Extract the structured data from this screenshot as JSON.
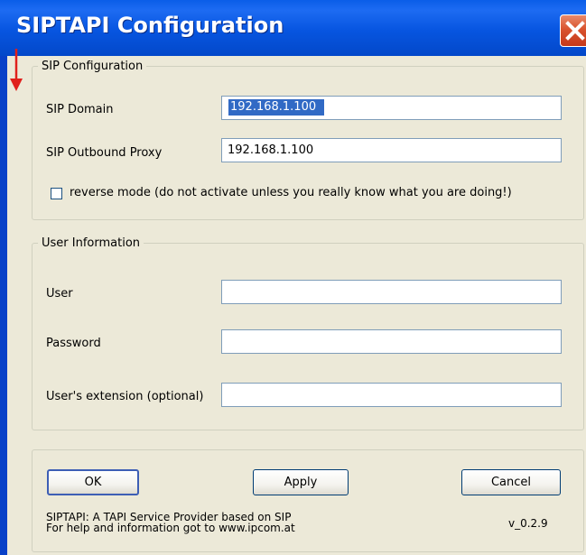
{
  "window": {
    "title": "SIPTAPI Configuration"
  },
  "sip_config": {
    "legend": "SIP Configuration",
    "domain_label": "SIP Domain",
    "domain_value": "192.168.1.100",
    "proxy_label": "SIP Outbound Proxy",
    "proxy_value": "192.168.1.100",
    "reverse_mode_label": "reverse mode (do not activate unless you really know what you are doing!)",
    "reverse_mode_checked": false
  },
  "user_info": {
    "legend": "User Information",
    "user_label": "User",
    "user_value": "",
    "password_label": "Password",
    "password_value": "",
    "extension_label": "User's extension (optional)",
    "extension_value": ""
  },
  "buttons": {
    "ok": "OK",
    "apply": "Apply",
    "cancel": "Cancel"
  },
  "footer": {
    "line1": "SIPTAPI: A TAPI Service Provider based on SIP",
    "line2": "For help and information got to www.ipcom.at",
    "version": "v_0.2.9"
  },
  "colors": {
    "titlebar": "#0755e0",
    "selection": "#316ac5",
    "arrow": "#e0201c",
    "close": "#d9532e"
  }
}
